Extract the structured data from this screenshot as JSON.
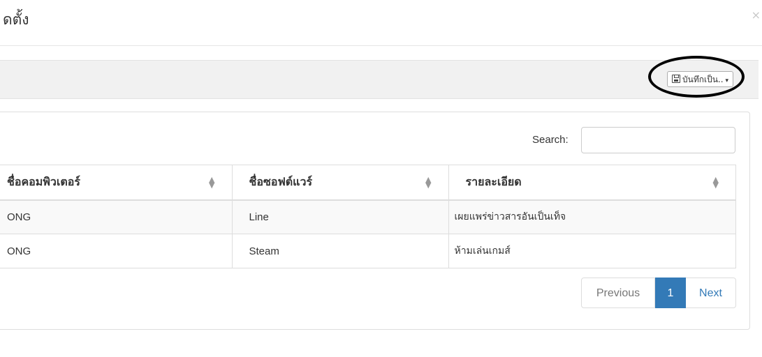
{
  "modal": {
    "title": "ดตั้ง",
    "close_glyph": "×"
  },
  "toolbar": {
    "save_label": "บันทึกเป็น..",
    "save_icon": "floppy-disk-icon",
    "caret": "▾"
  },
  "search": {
    "label": "Search:",
    "value": ""
  },
  "table": {
    "columns": [
      "ชื่อคอมพิวเตอร์",
      "ชื่อซอฟต์แวร์",
      "รายละเอียด"
    ],
    "rows": [
      [
        "ONG",
        "Line",
        "เผยแพร่ข่าวสารอันเป็นเท็จ"
      ],
      [
        "ONG",
        "Steam",
        "ห้ามเล่นเกมส์"
      ]
    ]
  },
  "pagination": {
    "previous": "Previous",
    "current": "1",
    "next": "Next"
  },
  "colors": {
    "accent": "#337ab7",
    "highlight": "#000000"
  }
}
